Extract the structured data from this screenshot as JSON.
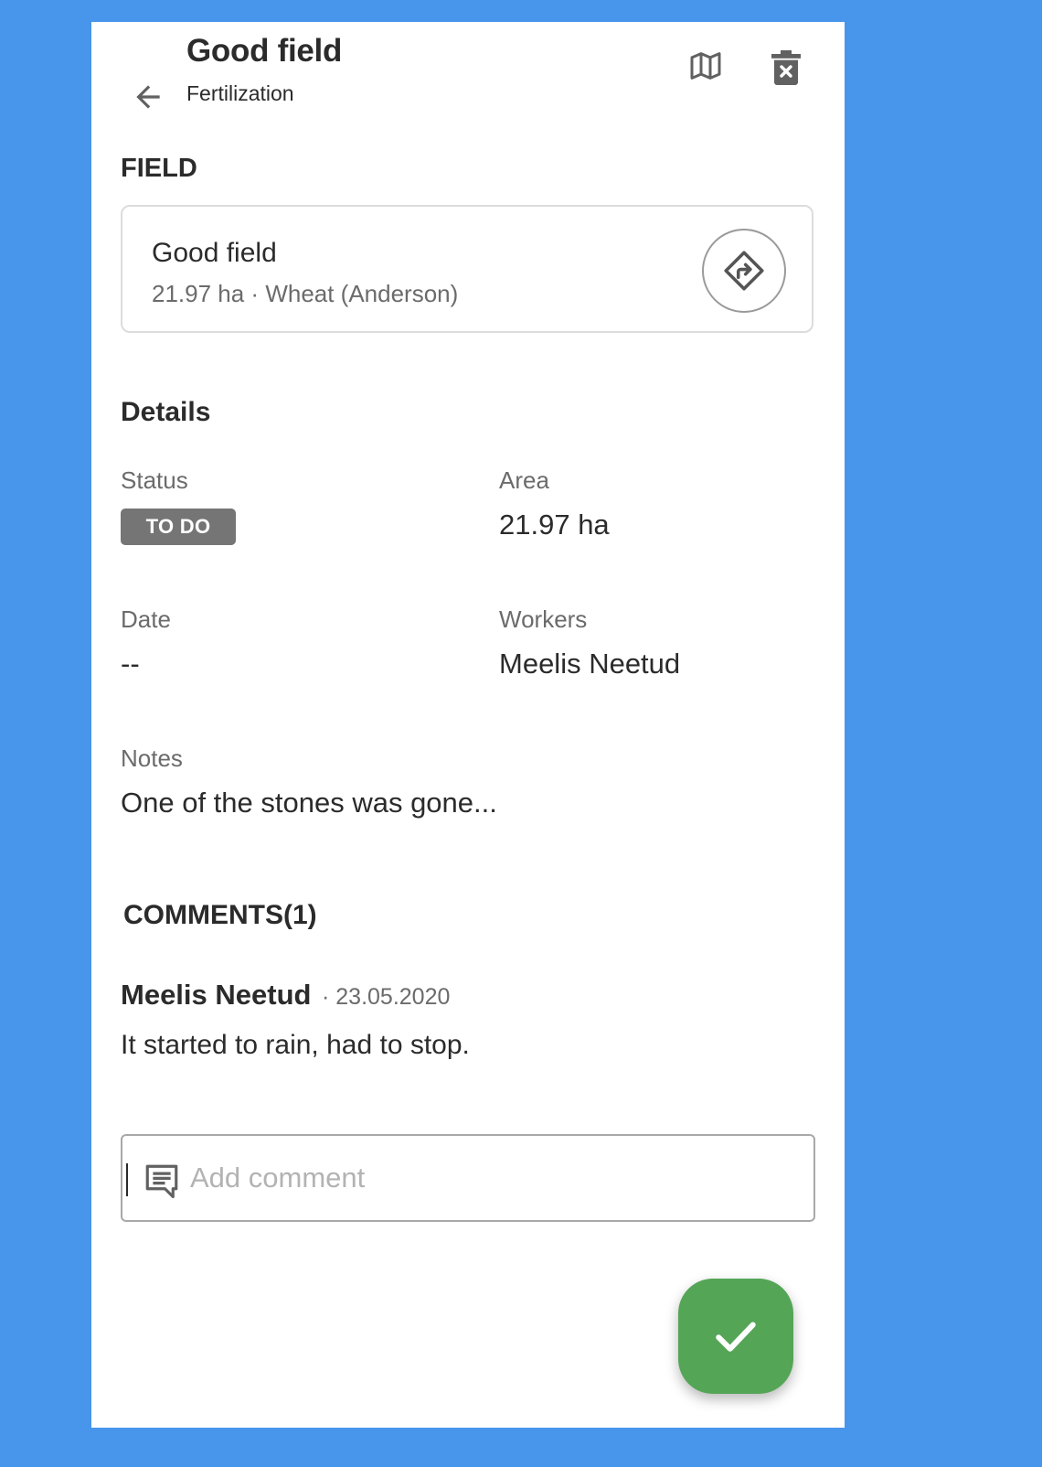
{
  "header": {
    "title": "Good field",
    "subtitle": "Fertilization"
  },
  "field_section": {
    "heading": "FIELD",
    "name": "Good field",
    "meta": "21.97 ha · Wheat (Anderson)"
  },
  "details": {
    "heading": "Details",
    "status_label": "Status",
    "status_value": "TO DO",
    "area_label": "Area",
    "area_value": "21.97 ha",
    "date_label": "Date",
    "date_value": "--",
    "workers_label": "Workers",
    "workers_value": "Meelis Neetud",
    "notes_label": "Notes",
    "notes_value": "One of the stones was gone..."
  },
  "comments": {
    "heading": "COMMENTS(1)",
    "items": [
      {
        "author": "Meelis Neetud",
        "date": "· 23.05.2020",
        "text": "It started to rain, had to stop."
      }
    ],
    "input_placeholder": "Add comment",
    "input_value": ""
  },
  "icons": {
    "back": "arrow-left-icon",
    "map": "map-icon",
    "delete": "trash-x-icon",
    "directions": "directions-icon",
    "comment": "comment-icon",
    "confirm": "check-icon"
  },
  "colors": {
    "background": "#4896EC",
    "status_badge": "#757575",
    "fab": "#55A557"
  }
}
